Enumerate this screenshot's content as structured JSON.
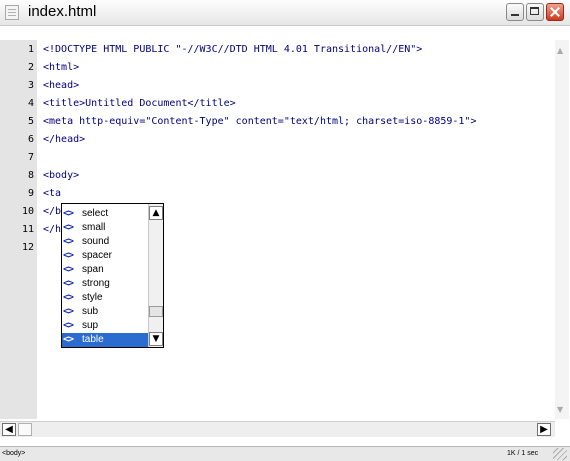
{
  "window": {
    "title": "index.html"
  },
  "editor": {
    "line_numbers": [
      "1",
      "2",
      "3",
      "4",
      "5",
      "6",
      "7",
      "8",
      "9",
      "10",
      "11",
      "12"
    ],
    "lines": [
      "<!DOCTYPE HTML PUBLIC \"-//W3C//DTD HTML 4.01 Transitional//EN\">",
      "<html>",
      "<head>",
      "<title>Untitled Document</title>",
      "<meta http-equiv=\"Content-Type\" content=\"text/html; charset=iso-8859-1\">",
      "</head>",
      "",
      "<body>",
      "<ta",
      "</b",
      "</h",
      ""
    ]
  },
  "autocomplete": {
    "items": [
      "select",
      "small",
      "sound",
      "spacer",
      "span",
      "strong",
      "style",
      "sub",
      "sup",
      "table"
    ],
    "selected": "table",
    "icon": "tag-icon"
  },
  "status": {
    "tag": "<body>",
    "size": "1K / 1 sec"
  }
}
